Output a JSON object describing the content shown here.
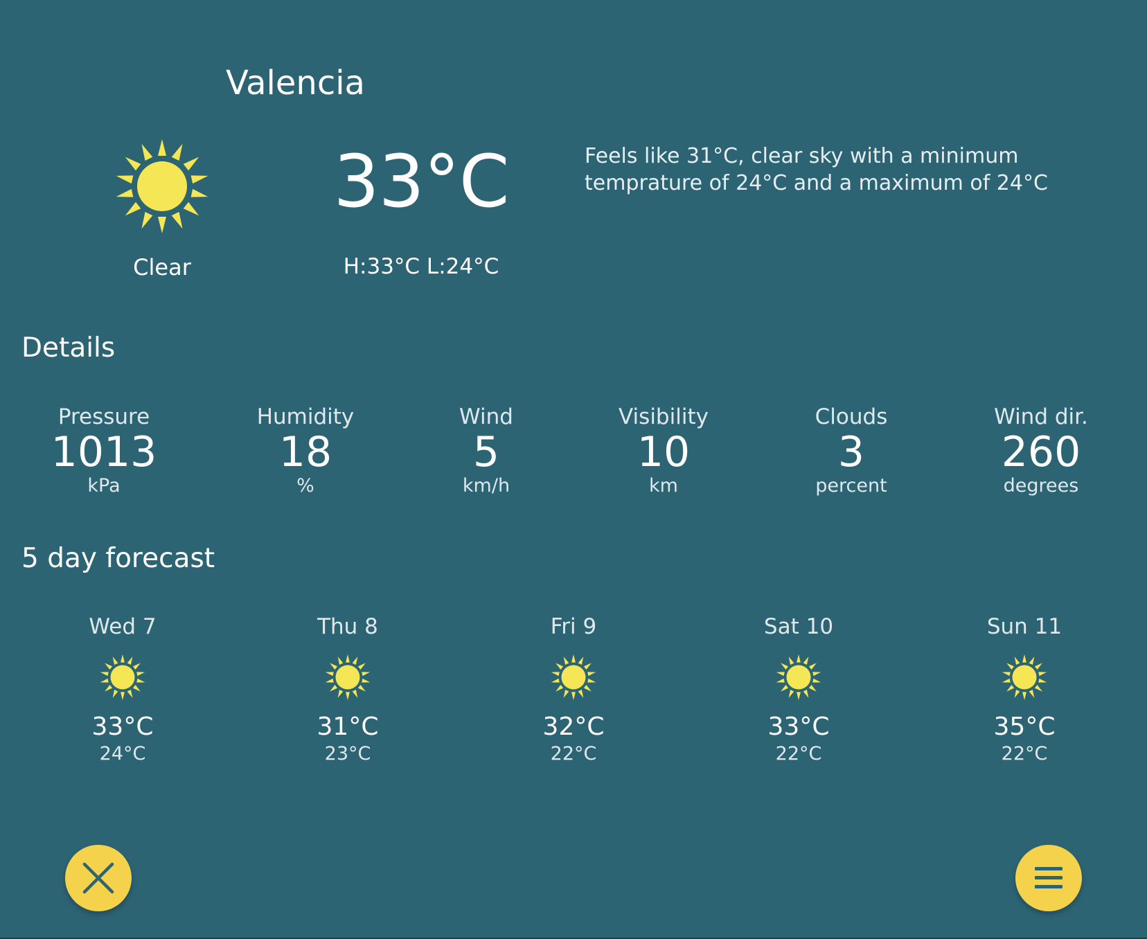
{
  "city": "Valencia",
  "current": {
    "temperature": "33°C",
    "condition": "Clear",
    "icon": "sun-icon",
    "high_low": "H:33°C L:24°C",
    "description": "Feels like 31°C, clear sky with a minimum temprature of 24°C and a maximum of 24°C"
  },
  "details": {
    "title": "Details",
    "items": [
      {
        "label": "Pressure",
        "value": "1013",
        "unit": "kPa"
      },
      {
        "label": "Humidity",
        "value": "18",
        "unit": "%"
      },
      {
        "label": "Wind",
        "value": "5",
        "unit": "km/h"
      },
      {
        "label": "Visibility",
        "value": "10",
        "unit": "km"
      },
      {
        "label": "Clouds",
        "value": "3",
        "unit": "percent"
      },
      {
        "label": "Wind dir.",
        "value": "260",
        "unit": "degrees"
      }
    ]
  },
  "forecast": {
    "title": "5 day forecast",
    "days": [
      {
        "day": "Wed 7",
        "icon": "sun-icon",
        "high": "33°C",
        "low": "24°C"
      },
      {
        "day": "Thu 8",
        "icon": "sun-icon",
        "high": "31°C",
        "low": "23°C"
      },
      {
        "day": "Fri 9",
        "icon": "sun-icon",
        "high": "32°C",
        "low": "22°C"
      },
      {
        "day": "Sat 10",
        "icon": "sun-icon",
        "high": "33°C",
        "low": "22°C"
      },
      {
        "day": "Sun 11",
        "icon": "sun-icon",
        "high": "35°C",
        "low": "22°C"
      }
    ]
  },
  "actions": {
    "close_icon": "close-icon",
    "menu_icon": "menu-icon"
  },
  "colors": {
    "background": "#2d6474",
    "sun": "#f5e656",
    "fab": "#f4d24c",
    "fab_icon": "#2d6474",
    "text": "#ffffff"
  }
}
